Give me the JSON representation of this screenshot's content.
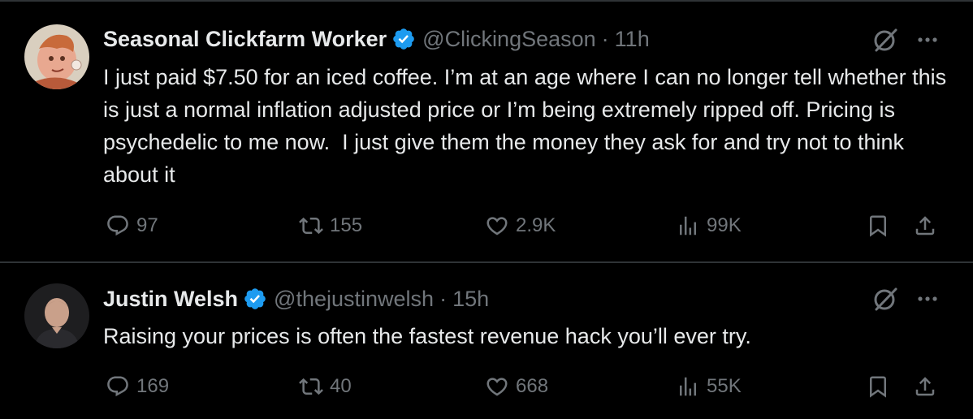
{
  "colors": {
    "background": "#000000",
    "text": "#e7e9ea",
    "secondary": "#71767b",
    "divider": "#2f3336",
    "verified": "#1d9bf0"
  },
  "tweets": [
    {
      "name": "Seasonal Clickfarm Worker",
      "handle": "@ClickingSeason",
      "separator": "·",
      "time": "11h",
      "text": "I just paid $7.50 for an iced coffee. I’m at an age where I can no longer tell whether this is just a normal inflation adjusted price or I’m being extremely ripped off. Pricing is psychedelic to me now.  I just give them the money they ask for and try not to think about it",
      "replies": "97",
      "retweets": "155",
      "likes": "2.9K",
      "views": "99K"
    },
    {
      "name": "Justin Welsh",
      "handle": "@thejustinwelsh",
      "separator": "·",
      "time": "15h",
      "text": "Raising your prices is often the fastest revenue hack you’ll ever try.",
      "replies": "169",
      "retweets": "40",
      "likes": "668",
      "views": "55K"
    }
  ],
  "icons": {
    "verified": "verified-badge-icon",
    "grok": "grok-icon",
    "more": "more-icon",
    "reply": "reply-icon",
    "retweet": "retweet-icon",
    "like": "heart-icon",
    "views": "views-icon",
    "bookmark": "bookmark-icon",
    "share": "share-icon"
  }
}
